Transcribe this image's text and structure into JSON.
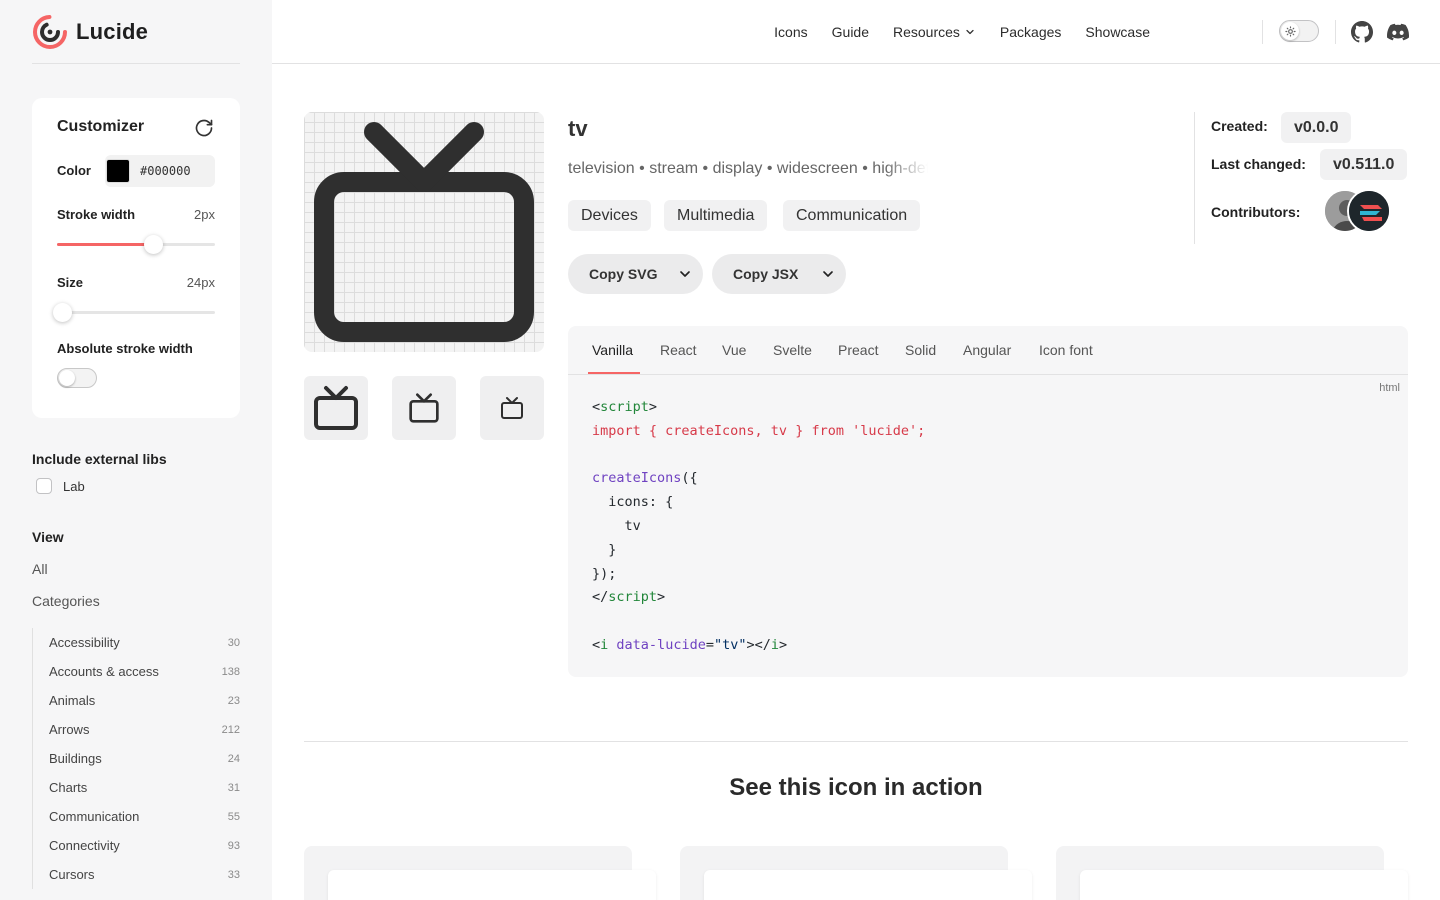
{
  "brand": {
    "name": "Lucide",
    "accent": "#f56565"
  },
  "nav": {
    "links": [
      "Icons",
      "Guide",
      "Resources",
      "Packages",
      "Showcase"
    ],
    "icons": [
      "sun-icon",
      "github-icon",
      "discord-icon"
    ]
  },
  "customizer": {
    "title": "Customizer",
    "color_label": "Color",
    "color_value": "#000000",
    "stroke_label": "Stroke width",
    "stroke_value": "2px",
    "stroke_fraction": 0.6,
    "size_label": "Size",
    "size_value": "24px",
    "size_fraction": 0.0,
    "absolute_label": "Absolute stroke width",
    "absolute_on": false
  },
  "sidebar": {
    "external_heading": "Include external libs",
    "lab_label": "Lab",
    "view_heading": "View",
    "view_all": "All",
    "view_categories": "Categories",
    "categories": [
      {
        "name": "Accessibility",
        "count": "30"
      },
      {
        "name": "Accounts & access",
        "count": "138"
      },
      {
        "name": "Animals",
        "count": "23"
      },
      {
        "name": "Arrows",
        "count": "212"
      },
      {
        "name": "Buildings",
        "count": "24"
      },
      {
        "name": "Charts",
        "count": "31"
      },
      {
        "name": "Communication",
        "count": "55"
      },
      {
        "name": "Connectivity",
        "count": "93"
      },
      {
        "name": "Cursors",
        "count": "33"
      }
    ]
  },
  "icon": {
    "name": "tv",
    "tags": "television • stream • display • widescreen • high-definition",
    "categories": [
      "Devices",
      "Multimedia",
      "Communication"
    ],
    "copy_svg": "Copy SVG",
    "copy_jsx": "Copy JSX"
  },
  "meta": {
    "created_label": "Created:",
    "created_value": "v0.0.0",
    "changed_label": "Last changed:",
    "changed_value": "v0.511.0",
    "contributors_label": "Contributors:"
  },
  "code": {
    "tabs": [
      "Vanilla",
      "React",
      "Vue",
      "Svelte",
      "Preact",
      "Solid",
      "Angular",
      "Icon font"
    ],
    "active_tab": "Vanilla",
    "lang": "html",
    "line1_open": "<",
    "line1_tag": "script",
    "line1_close": ">",
    "line2": "import { createIcons, tv } from 'lucide';",
    "line4_fn": "createIcons",
    "line4_rest": "({",
    "line5": "  icons: {",
    "line6": "    tv",
    "line7": "  }",
    "line8": "});",
    "line9_open": "</",
    "line9_tag": "script",
    "line9_close": ">",
    "line11_open": "<",
    "line11_tag": "i",
    "line11_attr": "data-lucide",
    "line11_eq": "=",
    "line11_str": "\"tv\"",
    "line11_end": "></",
    "line11_tag2": "i",
    "line11_close": ">"
  },
  "section": {
    "title": "See this icon in action"
  }
}
